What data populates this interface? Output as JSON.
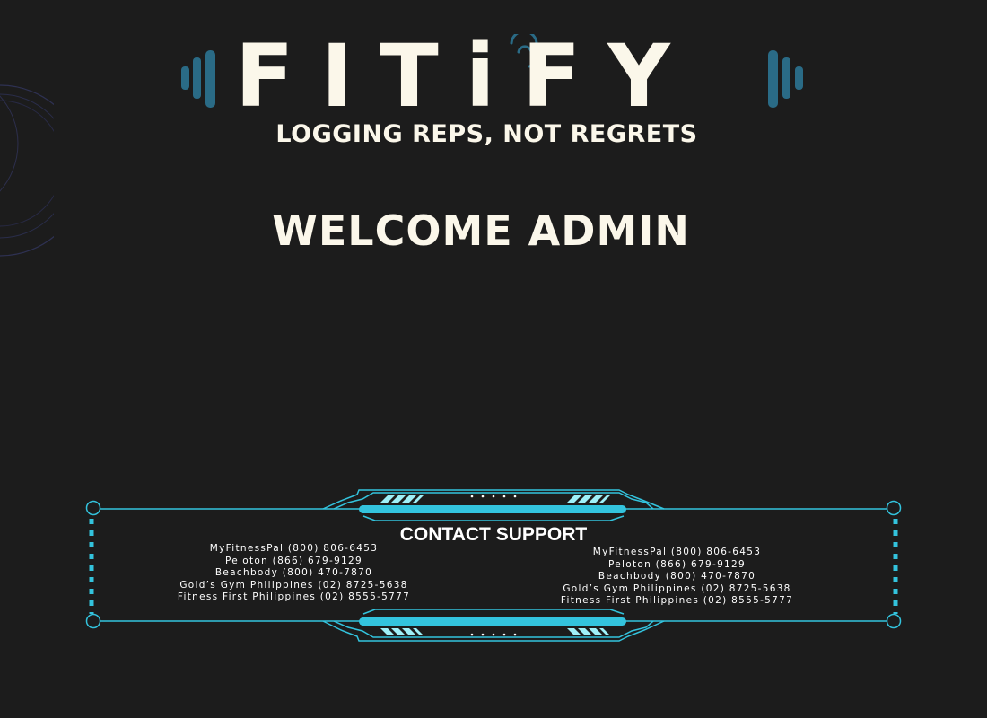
{
  "brand": {
    "wordmark": "FITiFY",
    "tagline": "LOGGING REPS, NOT REGRETS",
    "accent_color": "#2a6b86",
    "text_color": "#fbf7ea",
    "logo_icon": "dumbbell-icon"
  },
  "main": {
    "welcome": "WELCOME ADMIN"
  },
  "support": {
    "title": "CONTACT SUPPORT",
    "frame_color": "#33c3dd",
    "contacts_left": [
      "MyFitnessPal (800) 806-6453",
      "Peloton (866) 679-9129",
      "Beachbody (800) 470-7870",
      "Gold’s Gym Philippines (02) 8725-5638",
      "Fitness First Philippines (02) 8555-5777"
    ],
    "contacts_right": [
      "MyFitnessPal (800) 806-6453",
      "Peloton (866) 679-9129",
      "Beachbody (800) 470-7870",
      "Gold’s Gym Philippines (02) 8725-5638",
      "Fitness First Philippines (02) 8555-5777"
    ]
  }
}
